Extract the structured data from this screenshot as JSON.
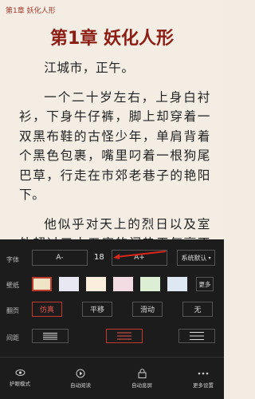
{
  "reader": {
    "chapter_small": "第1章 妖化人形",
    "chapter_title": "第1章 妖化人形",
    "paragraphs": [
      "江城市，正午。",
      "一个二十岁左右，上身白衬衫，下身牛仔裤，脚上却穿着一双黑布鞋的古怪少年，单肩背着个黑色包裹，嘴里叼着一根狗尾巴草，行走在市郊老巷子的艳阳下。",
      "他似乎对天上的烈日以及室外超过三十五度的闷热天气毫不在意，一边走，一边还哼着首不知名的"
    ]
  },
  "settings": {
    "font_label": "字体",
    "font_decrease": "A-",
    "font_size": "18",
    "font_increase": "A+",
    "font_default": "系统默认",
    "wallpaper_label": "壁纸",
    "wallpaper_colors": [
      "#f1e3c6",
      "#e8e8f3",
      "#fbeedd",
      "#f3dde3",
      "#dcefd5",
      "#dde8f3"
    ],
    "wallpaper_more": "更多",
    "page_turn_label": "翻页",
    "page_turn_options": [
      "仿真",
      "平移",
      "滑动",
      "无"
    ],
    "spacing_label": "间距"
  },
  "toolbar": {
    "eye_mode": "护眼模式",
    "auto_read": "自动阅读",
    "auto_lock": "自动息屏",
    "more_settings": "更多设置"
  },
  "colors": {
    "accent": "#c0392b",
    "title": "#8b1d14",
    "panel_bg": "#1c1c1c"
  }
}
